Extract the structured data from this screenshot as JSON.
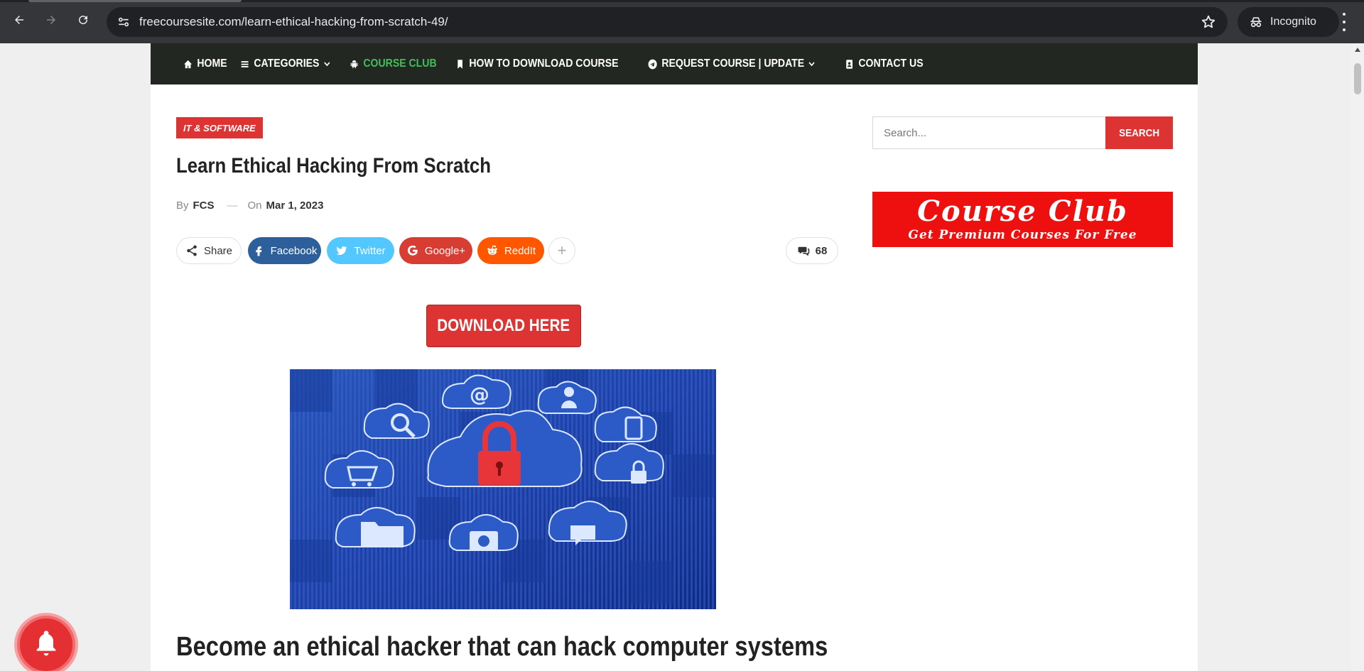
{
  "browser": {
    "url": "freecoursesite.com/learn-ethical-hacking-from-scratch-49/",
    "profile_label": "Incognito"
  },
  "topnav": {
    "items": [
      {
        "label": "HOME",
        "icon": "home-icon"
      },
      {
        "label": "CATEGORIES",
        "icon": "menu-icon",
        "dropdown": true
      },
      {
        "label": "COURSE CLUB",
        "icon": "android-icon",
        "color": "#3fc05b"
      },
      {
        "label": "HOW TO DOWNLOAD COURSE",
        "icon": "bookmark-icon"
      },
      {
        "label": "REQUEST COURSE | UPDATE",
        "icon": "telegram-icon",
        "dropdown": true
      },
      {
        "label": "CONTACT US",
        "icon": "contact-book-icon"
      }
    ]
  },
  "post": {
    "category": "IT & SOFTWARE",
    "title": "Learn Ethical Hacking From Scratch",
    "by_label": "By",
    "author": "FCS",
    "date_prefix": "On",
    "date": "Mar 1, 2023",
    "share": {
      "share_label": "Share",
      "facebook": "Facebook",
      "twitter": "Twitter",
      "google": "Google+",
      "reddit": "ReddIt",
      "more": "+",
      "comments_count": "68"
    },
    "download_label": "DOWNLOAD HERE",
    "subheading": "Become an ethical hacker that can hack computer systems"
  },
  "sidebar": {
    "search_placeholder": "Search...",
    "search_button": "SEARCH",
    "ad": {
      "title": "Course Club",
      "subtitle": "Get Premium Courses For Free"
    }
  },
  "colors": {
    "accent": "#dd3333",
    "nav_bg": "#222722",
    "nav_highlight": "#3fc05b",
    "facebook": "#2d5f9a",
    "twitter": "#53c7ff",
    "google": "#d73d32",
    "reddit": "#ff5700"
  }
}
